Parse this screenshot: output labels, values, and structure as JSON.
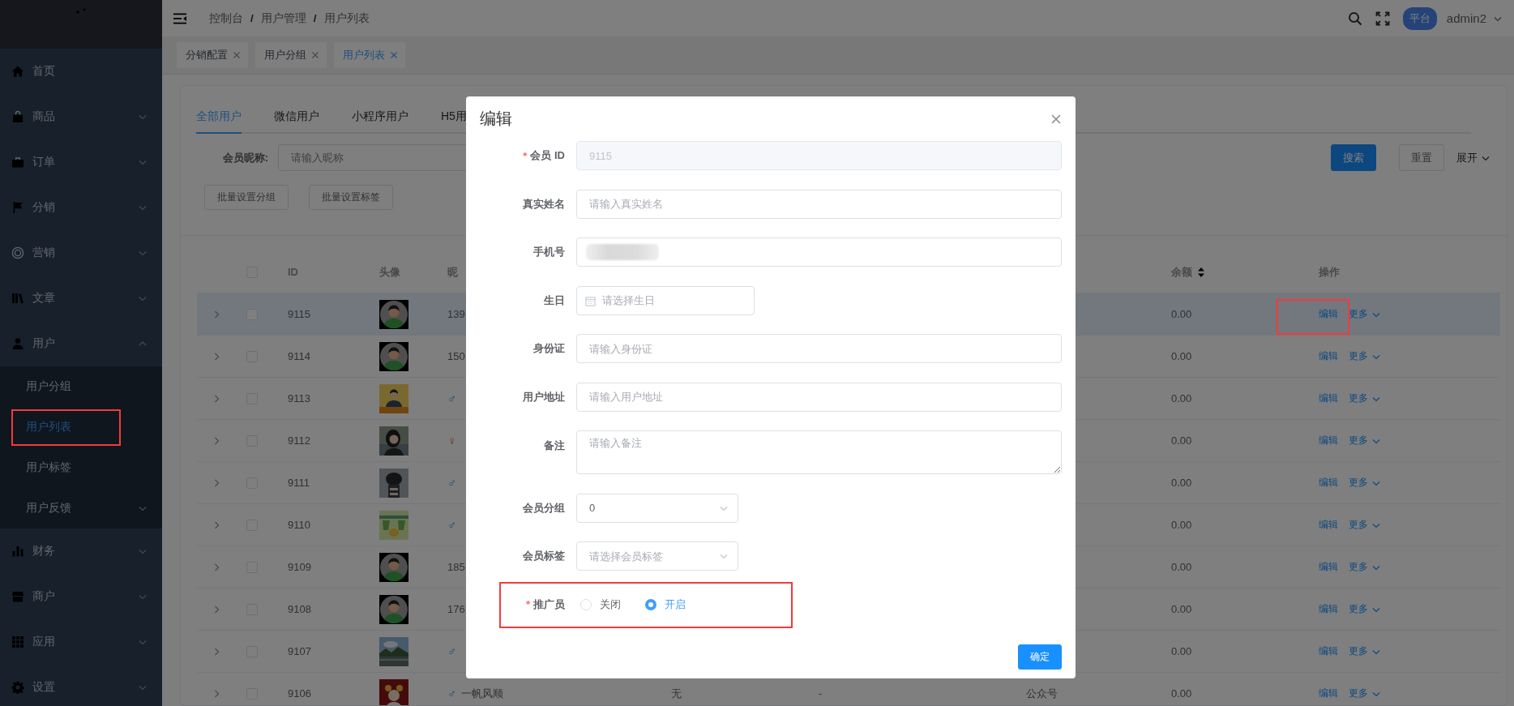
{
  "sidebar": {
    "items": [
      {
        "label": "首页",
        "selected": false
      },
      {
        "label": "商品",
        "expanded": false,
        "selected": false
      },
      {
        "label": "订单",
        "expanded": false,
        "selected": false
      },
      {
        "label": "分销",
        "expanded": false,
        "selected": false
      },
      {
        "label": "营销",
        "expanded": false,
        "selected": false
      },
      {
        "label": "文章",
        "expanded": false,
        "selected": false
      },
      {
        "label": "用户",
        "expanded": true,
        "selected": false,
        "children": [
          {
            "label": "用户分组",
            "selected": false,
            "highlighted": false
          },
          {
            "label": "用户列表",
            "selected": true,
            "highlighted": true
          },
          {
            "label": "用户标签",
            "selected": false,
            "highlighted": false
          },
          {
            "label": "用户反馈",
            "selected": false,
            "highlighted": false,
            "expanded": false
          }
        ]
      },
      {
        "label": "财务",
        "expanded": false,
        "selected": false
      },
      {
        "label": "商户",
        "expanded": false,
        "selected": false
      },
      {
        "label": "应用",
        "expanded": false,
        "selected": false
      },
      {
        "label": "设置",
        "expanded": false,
        "selected": false
      }
    ]
  },
  "header": {
    "breadcrumb": [
      "控制台",
      "用户管理",
      "用户列表"
    ],
    "separator": "/",
    "badge": "平台",
    "user": "admin2"
  },
  "tags": [
    {
      "label": "分销配置",
      "selected": false
    },
    {
      "label": "用户分组",
      "selected": false
    },
    {
      "label": "用户列表",
      "selected": true
    }
  ],
  "tabs": [
    {
      "label": "全部用户",
      "selected": true
    },
    {
      "label": "微信用户",
      "selected": false
    },
    {
      "label": "小程序用户",
      "selected": false
    },
    {
      "label": "H5用",
      "selected": false
    }
  ],
  "filter": {
    "label": "会员昵称:",
    "placeholder": "请输入昵称",
    "search": "搜索",
    "reset": "重置",
    "expand": "展开"
  },
  "batch_buttons": [
    "批量设置分组",
    "批量设置标签"
  ],
  "table": {
    "select_all": {
      "checked": false
    },
    "header": {
      "id": "ID",
      "avatar": "头像",
      "nickname": "昵",
      "balance": "余额",
      "actions": "操作"
    },
    "rows": [
      {
        "id": "9115",
        "avatar": {
          "kind": "icon"
        },
        "nickname": "139",
        "balance": "0.00",
        "edit": "编辑",
        "more": "更多",
        "selected": true,
        "checked": false,
        "highlighted": true
      },
      {
        "id": "9114",
        "avatar": {
          "kind": "icon"
        },
        "nickname": "150",
        "balance": "0.00",
        "edit": "编辑",
        "more": "更多",
        "selected": false,
        "checked": false,
        "highlighted": false
      },
      {
        "id": "9113",
        "sign": {
          "text": "♂",
          "kind": "male"
        },
        "balance": "0.00",
        "edit": "编辑",
        "more": "更多",
        "selected": false,
        "checked": false,
        "highlighted": false
      },
      {
        "id": "9112",
        "sign": {
          "text": "♀",
          "kind": "female"
        },
        "balance": "0.00",
        "edit": "编辑",
        "more": "更多",
        "selected": false,
        "checked": false,
        "highlighted": false
      },
      {
        "id": "9111",
        "sign": {
          "text": "♂",
          "kind": "male"
        },
        "balance": "0.00",
        "edit": "编辑",
        "more": "更多",
        "selected": false,
        "checked": false,
        "highlighted": false
      },
      {
        "id": "9110",
        "sign": {
          "text": "♂",
          "kind": "male"
        },
        "balance": "0.00",
        "edit": "编辑",
        "more": "更多",
        "selected": false,
        "checked": false,
        "highlighted": false
      },
      {
        "id": "9109",
        "avatar": {
          "kind": "icon"
        },
        "nickname": "185",
        "balance": "0.00",
        "edit": "编辑",
        "more": "更多",
        "selected": false,
        "checked": false,
        "highlighted": false
      },
      {
        "id": "9108",
        "avatar": {
          "kind": "icon"
        },
        "nickname": "176",
        "balance": "0.00",
        "edit": "编辑",
        "more": "更多",
        "selected": false,
        "checked": false,
        "highlighted": false
      },
      {
        "id": "9107",
        "sign": {
          "text": "♂",
          "kind": "male"
        },
        "balance": "0.00",
        "edit": "编辑",
        "more": "更多",
        "selected": false,
        "checked": false,
        "highlighted": false
      },
      {
        "id": "9106",
        "sign": {
          "text": "♂",
          "kind": "male"
        },
        "nickname": "一帆风顺",
        "column_6": "无",
        "column_7": "-",
        "column_8": "公众号",
        "balance": "0.00",
        "edit": "编辑",
        "more": "更多",
        "selected": false,
        "checked": false,
        "highlighted": false
      }
    ]
  },
  "modal": {
    "title": "编辑",
    "confirm": "确定",
    "fields": [
      {
        "kind": "text",
        "label": "会员 ID",
        "required_mark": "*",
        "value": "9115",
        "disabled": true,
        "highlighted": false
      },
      {
        "kind": "text",
        "label": "真实姓名",
        "placeholder": "请输入真实姓名",
        "highlighted": false
      },
      {
        "kind": "redacted",
        "label": "手机号",
        "highlighted": false
      },
      {
        "kind": "date",
        "label": "生日",
        "placeholder": "请选择生日",
        "highlighted": false
      },
      {
        "kind": "text",
        "label": "身份证",
        "placeholder": "请输入身份证",
        "highlighted": false
      },
      {
        "kind": "text",
        "label": "用户地址",
        "placeholder": "请输入用户地址",
        "highlighted": false
      },
      {
        "kind": "textarea",
        "label": "备注",
        "placeholder": "请输入备注",
        "highlighted": false
      },
      {
        "kind": "select",
        "label": "会员分组",
        "value": "0",
        "highlighted": false
      },
      {
        "kind": "select",
        "label": "会员标签",
        "placeholder": "请选择会员标签",
        "highlighted": false
      },
      {
        "kind": "radio",
        "label": "推广员",
        "required_mark": "*",
        "highlighted": true,
        "options": [
          {
            "label": "关闭",
            "selected": false
          },
          {
            "label": "开启",
            "selected": true
          }
        ]
      }
    ]
  }
}
